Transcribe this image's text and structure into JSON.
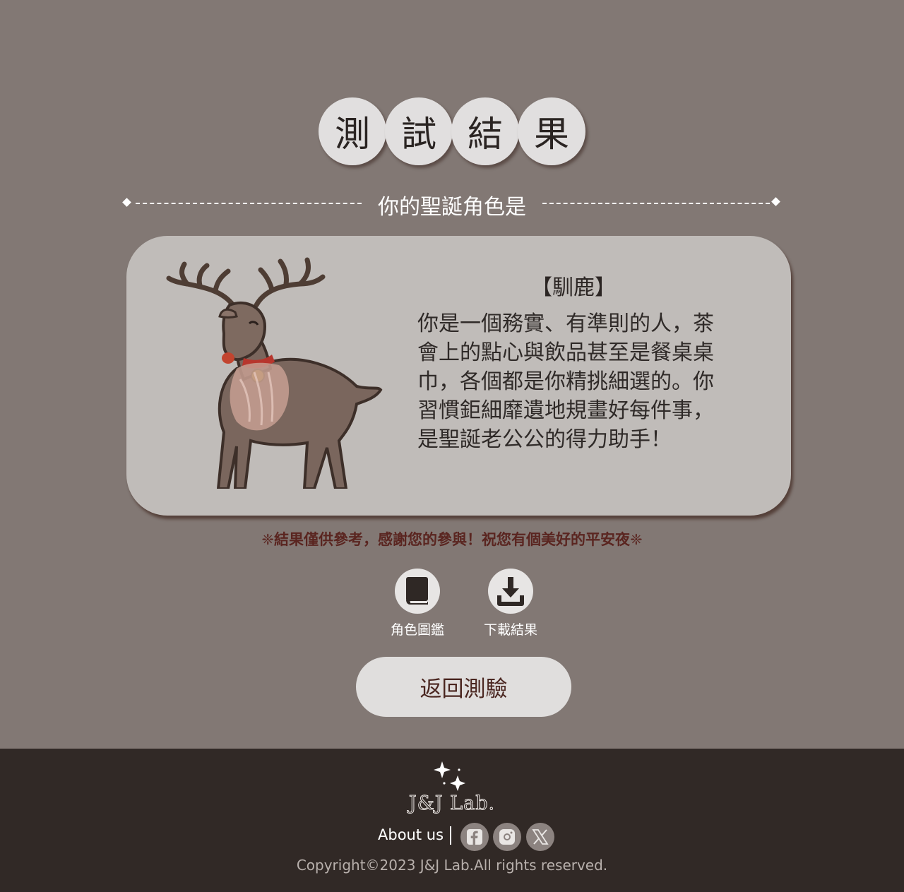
{
  "header": {
    "title_chars": [
      "測",
      "試",
      "結",
      "果"
    ],
    "subtitle": "你的聖誕角色是"
  },
  "result": {
    "role_name": "【馴鹿】",
    "description": "你是一個務實、有準則的人，茶會上的點心與飲品甚至是餐桌桌巾，各個都是你精挑細選的。你習慣鉅細靡遺地規畫好每件事，是聖誕老公公的得力助手！",
    "image_icon": "reindeer-illustration"
  },
  "note": "❈結果僅供參考，感謝您的參與！祝您有個美好的平安夜❈",
  "actions": {
    "guide_label": "角色圖鑑",
    "guide_icon": "book-icon",
    "download_label": "下載結果",
    "download_icon": "download-icon"
  },
  "back_button": "返回測驗",
  "footer": {
    "logo_text": "J&J Lab.",
    "about": "About us",
    "social_icons": [
      "facebook-icon",
      "instagram-icon",
      "x-icon"
    ],
    "copyright": "Copyright©2023 J&J Lab.All rights reserved."
  },
  "colors": {
    "page_bg": "#827874",
    "card_bg": "#c0bcb9",
    "circle_bg": "#e1dfdf",
    "note_text": "#5a2520",
    "footer_bg": "#312926"
  }
}
